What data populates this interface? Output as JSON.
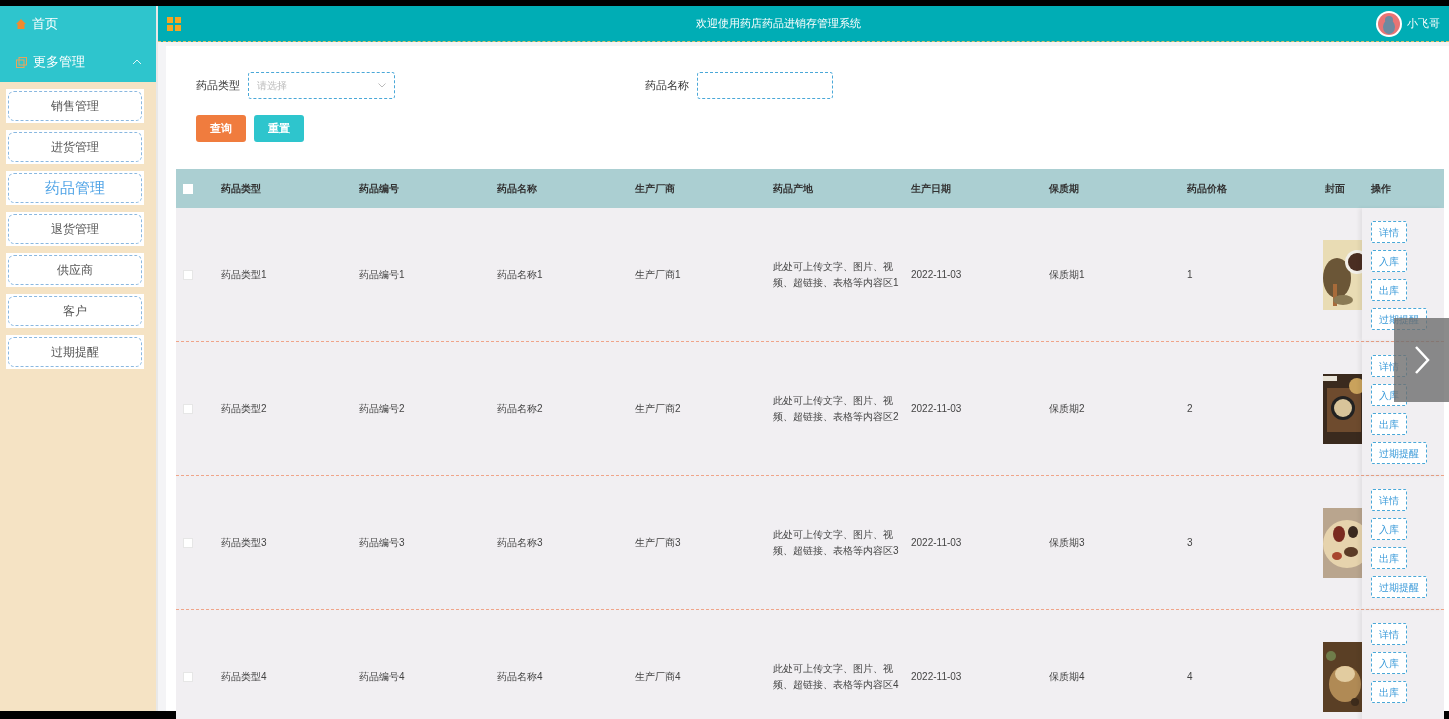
{
  "header": {
    "title": "欢迎使用药店药品进销存管理系统",
    "user": "小飞哥"
  },
  "sidebar": {
    "home": "首页",
    "group": {
      "label": "更多管理",
      "expanded": true
    },
    "items": [
      {
        "label": "销售管理",
        "selected": false
      },
      {
        "label": "进货管理",
        "selected": false
      },
      {
        "label": "药品管理",
        "selected": true
      },
      {
        "label": "退货管理",
        "selected": false
      },
      {
        "label": "供应商",
        "selected": false
      },
      {
        "label": "客户",
        "selected": false
      },
      {
        "label": "过期提醒",
        "selected": false
      }
    ]
  },
  "search": {
    "fields": [
      {
        "label": "药品类型",
        "kind": "select",
        "placeholder": "请选择"
      },
      {
        "label": "药品名称",
        "kind": "text"
      }
    ],
    "buttons": [
      {
        "label": "查询",
        "kind": "primary"
      },
      {
        "label": "重置",
        "kind": "secondary"
      }
    ]
  },
  "table": {
    "select_all": false,
    "columns": [
      "药品类型",
      "药品编号",
      "药品名称",
      "生产厂商",
      "药品产地",
      "生产日期",
      "保质期",
      "药品价格",
      "封面",
      "操作"
    ],
    "rows": [
      {
        "checked": false,
        "cells": [
          "药品类型1",
          "药品编号1",
          "药品名称1",
          "生产厂商1",
          "此处可上传文字、图片、视频、超链接、表格等内容区1",
          "2022-11-03",
          "保质期1",
          "1"
        ],
        "actions": [
          "详情",
          "入库",
          "出库",
          "过期提醒"
        ]
      },
      {
        "checked": false,
        "cells": [
          "药品类型2",
          "药品编号2",
          "药品名称2",
          "生产厂商2",
          "此处可上传文字、图片、视频、超链接、表格等内容区2",
          "2022-11-03",
          "保质期2",
          "2"
        ],
        "actions": [
          "详情",
          "入库",
          "出库",
          "过期提醒"
        ]
      },
      {
        "checked": false,
        "cells": [
          "药品类型3",
          "药品编号3",
          "药品名称3",
          "生产厂商3",
          "此处可上传文字、图片、视频、超链接、表格等内容区3",
          "2022-11-03",
          "保质期3",
          "3"
        ],
        "actions": [
          "详情",
          "入库",
          "出库",
          "过期提醒"
        ]
      },
      {
        "checked": false,
        "cells": [
          "药品类型4",
          "药品编号4",
          "药品名称4",
          "生产厂商4",
          "此处可上传文字、图片、视频、超链接、表格等内容区4",
          "2022-11-03",
          "保质期4",
          "4"
        ],
        "actions": [
          "详情",
          "入库",
          "出库"
        ]
      }
    ]
  }
}
